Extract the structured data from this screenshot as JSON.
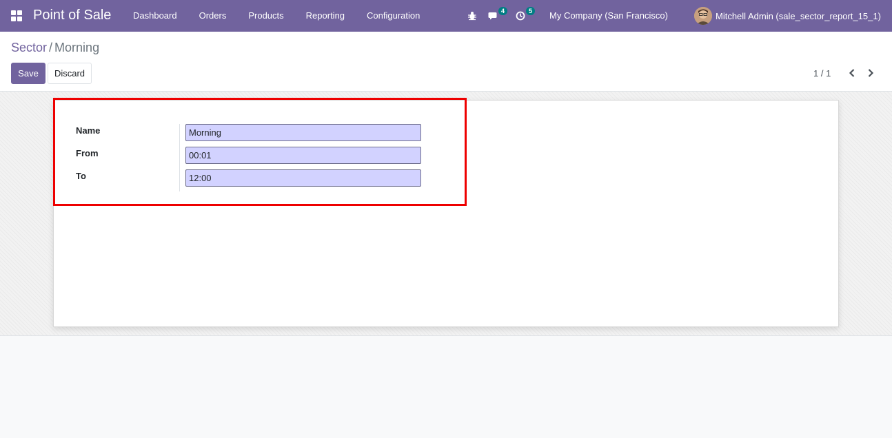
{
  "navbar": {
    "brand": "Point of Sale",
    "menu": [
      "Dashboard",
      "Orders",
      "Products",
      "Reporting",
      "Configuration"
    ],
    "chat_badge": "4",
    "activity_badge": "5",
    "company": "My Company (San Francisco)",
    "user": "Mitchell Admin (sale_sector_report_15_1)"
  },
  "breadcrumb": {
    "parent": "Sector",
    "separator": "/",
    "current": "Morning"
  },
  "buttons": {
    "save": "Save",
    "discard": "Discard"
  },
  "pager": {
    "value": "1 / 1"
  },
  "form": {
    "fields": [
      {
        "label": "Name",
        "value": "Morning"
      },
      {
        "label": "From",
        "value": "00:01"
      },
      {
        "label": "To",
        "value": "12:00"
      }
    ]
  },
  "colors": {
    "brand": "#71639e",
    "input_bg": "#d2d2ff",
    "highlight": "#ee0000",
    "badge": "#017e84"
  }
}
